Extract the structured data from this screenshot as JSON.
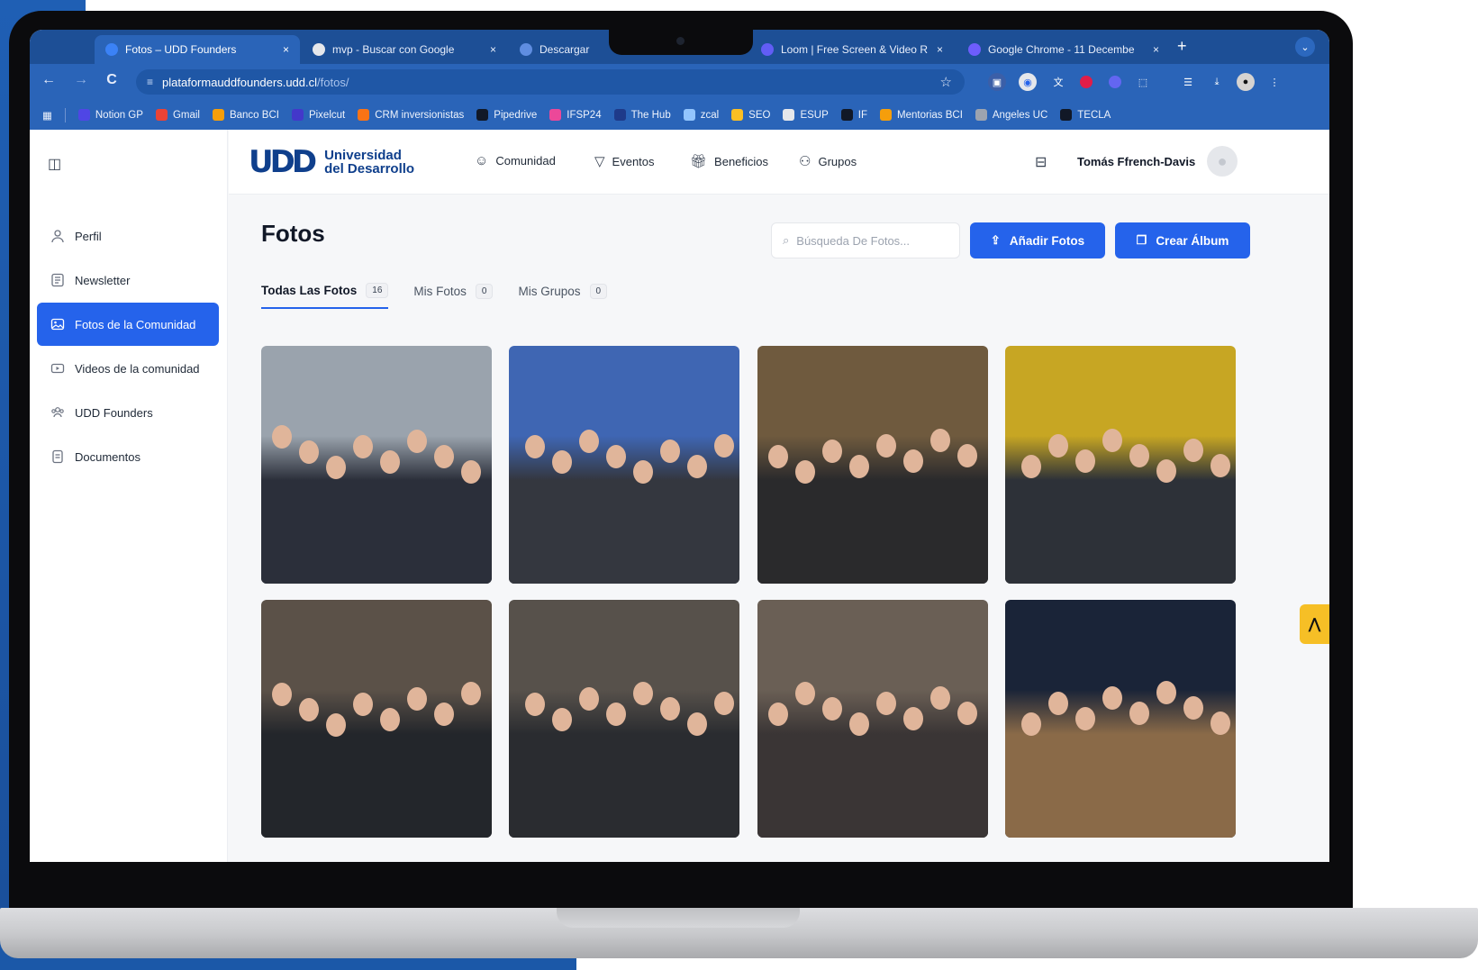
{
  "browser": {
    "tabs": [
      {
        "label": "Fotos – UDD Founders",
        "close": "×",
        "color": "#3b82f6"
      },
      {
        "label": "mvp - Buscar con Google",
        "close": "×",
        "color": "#e5e7eb"
      },
      {
        "label": "Descargar",
        "close": "",
        "color": "#5f8de0"
      },
      {
        "label": "Loom | Free Screen & Video R",
        "close": "×",
        "color": "#625df5"
      },
      {
        "label": "Google Chrome - 11 Decembe",
        "close": "×",
        "color": "#6d5dfc"
      }
    ],
    "new_tab": "+",
    "tab_menu": "⌄",
    "back": "←",
    "forward": "→",
    "reload": "C",
    "url_host": "plataformauddfounders.udd.cl",
    "url_path": "/fotos/",
    "bookmarks": [
      {
        "label": "Notion GP",
        "color": "#4f46e5"
      },
      {
        "label": "Gmail",
        "color": "#ea4335"
      },
      {
        "label": "Banco BCI",
        "color": "#f59e0b"
      },
      {
        "label": "Pixelcut",
        "color": "#4338ca"
      },
      {
        "label": "CRM inversionistas",
        "color": "#f97316"
      },
      {
        "label": "Pipedrive",
        "color": "#111827"
      },
      {
        "label": "IFSP24",
        "color": "#ec4899"
      },
      {
        "label": "The Hub",
        "color": "#1e3a8a"
      },
      {
        "label": "zcal",
        "color": "#93c5fd"
      },
      {
        "label": "SEO",
        "color": "#fbbf24"
      },
      {
        "label": "ESUP",
        "color": "#e5e7eb"
      },
      {
        "label": "IF",
        "color": "#111827"
      },
      {
        "label": "Mentorias BCI",
        "color": "#f59e0b"
      },
      {
        "label": "Angeles UC",
        "color": "#9ca3af"
      },
      {
        "label": "TECLA",
        "color": "#111827"
      }
    ]
  },
  "sidebar": {
    "items": [
      {
        "label": "Perfil",
        "icon": "user-icon"
      },
      {
        "label": "Newsletter",
        "icon": "newsletter-icon"
      },
      {
        "label": "Fotos de la Comunidad",
        "icon": "photos-icon",
        "active": true
      },
      {
        "label": "Videos de la comunidad",
        "icon": "video-icon"
      },
      {
        "label": "UDD Founders",
        "icon": "group-icon"
      },
      {
        "label": "Documentos",
        "icon": "document-icon"
      }
    ]
  },
  "header": {
    "logo_mark": "UDD",
    "logo_line1": "Universidad",
    "logo_line2": "del Desarrollo",
    "nav": [
      {
        "label": "Comunidad",
        "icon": "smile-icon"
      },
      {
        "label": "Eventos",
        "icon": "cup-icon"
      },
      {
        "label": "Beneficios",
        "icon": "gift-icon"
      },
      {
        "label": "Grupos",
        "icon": "group-icon"
      }
    ],
    "user_name": "Tomás Ffrench-Davis"
  },
  "main": {
    "title": "Fotos",
    "search_placeholder": "Búsqueda De Fotos...",
    "add_button": "Añadir Fotos",
    "create_button": "Crear Álbum",
    "tabs": [
      {
        "label": "Todas Las Fotos",
        "count": "16",
        "active": true
      },
      {
        "label": "Mis Fotos",
        "count": "0"
      },
      {
        "label": "Mis Grupos",
        "count": "0"
      }
    ],
    "photos": [
      {
        "bg": "#9aa3ad",
        "crowd": "#2b2f3a"
      },
      {
        "bg": "#3f66b3",
        "crowd": "#34373f"
      },
      {
        "bg": "#6f5a3e",
        "crowd": "#2a2a2c"
      },
      {
        "bg": "#c7a623",
        "crowd": "#2d3138"
      },
      {
        "bg": "#5b5148",
        "crowd": "#23262b"
      },
      {
        "bg": "#57514b",
        "crowd": "#2a2c30"
      },
      {
        "bg": "#6a5f55",
        "crowd": "#3a3535"
      },
      {
        "bg": "#1a2438",
        "crowd": "#8a6a48"
      }
    ]
  },
  "colors": {
    "accent": "#2563eb",
    "chrome": "#2a64b8",
    "fab": "#f6bf26"
  }
}
